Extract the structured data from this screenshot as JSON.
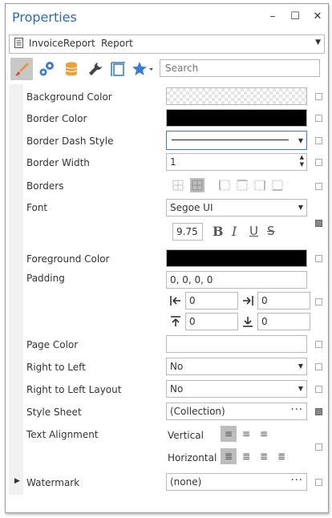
{
  "window": {
    "title": "Properties",
    "controls": {
      "minimize": "–",
      "maximize": "☐",
      "close": "✕"
    }
  },
  "object_selector": {
    "name": "InvoiceReport",
    "type": "Report"
  },
  "toolbar": {
    "search_placeholder": "Search",
    "tabs": [
      {
        "icon": "brush-icon",
        "selected": true
      },
      {
        "icon": "gears-icon",
        "selected": false
      },
      {
        "icon": "database-icon",
        "selected": false
      },
      {
        "icon": "wrench-icon",
        "selected": false
      },
      {
        "icon": "layout-icon",
        "selected": false
      },
      {
        "icon": "star-icon",
        "selected": false
      }
    ]
  },
  "properties": {
    "background_color": {
      "label": "Background Color"
    },
    "border_color": {
      "label": "Border Color",
      "color": "#000000"
    },
    "border_dash_style": {
      "label": "Border Dash Style"
    },
    "border_width": {
      "label": "Border Width",
      "value": "1"
    },
    "borders": {
      "label": "Borders"
    },
    "font": {
      "label": "Font",
      "family": "Segoe UI",
      "size": "9.75",
      "bold": "B",
      "italic": "I",
      "underline": "U",
      "strike": "S"
    },
    "foreground_color": {
      "label": "Foreground Color",
      "color": "#000000"
    },
    "padding": {
      "label": "Padding",
      "value": "0, 0, 0, 0",
      "left": "0",
      "right": "0",
      "top": "0",
      "bottom": "0"
    },
    "page_color": {
      "label": "Page Color"
    },
    "right_to_left": {
      "label": "Right to Left",
      "value": "No"
    },
    "right_to_left_layout": {
      "label": "Right to Left Layout",
      "value": "No"
    },
    "style_sheet": {
      "label": "Style Sheet",
      "value": "(Collection)"
    },
    "text_alignment": {
      "label": "Text Alignment",
      "vertical_label": "Vertical",
      "horizontal_label": "Horizontal"
    },
    "watermark": {
      "label": "Watermark",
      "value": "(none)"
    }
  }
}
